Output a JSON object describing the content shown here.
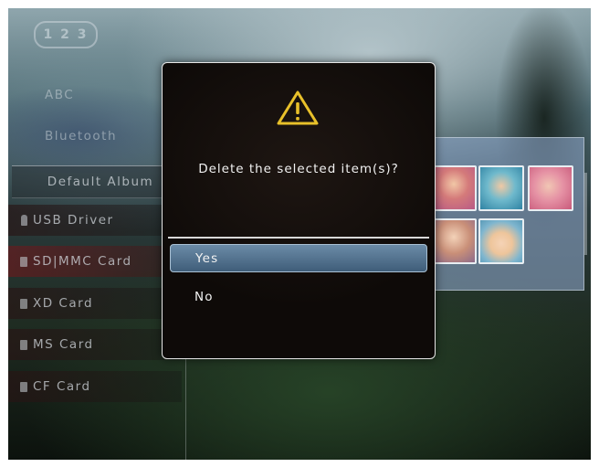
{
  "header": {
    "logo_text": "1 2 3"
  },
  "sidebar": {
    "items": [
      {
        "label": "ABC",
        "icon": ""
      },
      {
        "label": "Bluetooth",
        "icon": ""
      },
      {
        "label": "Default Album",
        "icon": ""
      },
      {
        "label": "USB Driver",
        "icon": "usb-icon"
      },
      {
        "label": "SD|MMC Card",
        "icon": "card-icon"
      },
      {
        "label": "XD Card",
        "icon": "card-icon"
      },
      {
        "label": "MS Card",
        "icon": "card-icon"
      },
      {
        "label": "CF Card",
        "icon": "card-icon"
      }
    ]
  },
  "dialog": {
    "icon": "warning-icon",
    "message": "Delete the selected item(s)?",
    "options": [
      {
        "label": "Yes",
        "selected": true
      },
      {
        "label": "No",
        "selected": false
      }
    ]
  },
  "colors": {
    "dialog_bg": "#0e0a08",
    "selection_top": "#6b8ba7",
    "selection_bottom": "#3f5d79",
    "warning_yellow": "#e8c02a"
  }
}
